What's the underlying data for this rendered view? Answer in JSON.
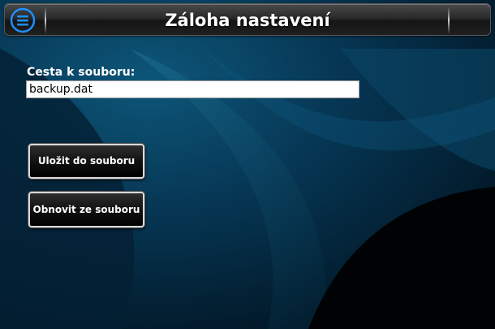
{
  "header": {
    "title": "Záloha nastavení",
    "menu_icon": "hamburger-menu-icon"
  },
  "form": {
    "path_label": "Cesta k souboru:",
    "path_value": "backup.dat"
  },
  "actions": {
    "save_label": "Uložit do souboru",
    "restore_label": "Obnovit ze souboru"
  },
  "colors": {
    "background": "#031b2e",
    "accent_blue": "#1e90ff",
    "button_border": "#d9d9d9"
  }
}
